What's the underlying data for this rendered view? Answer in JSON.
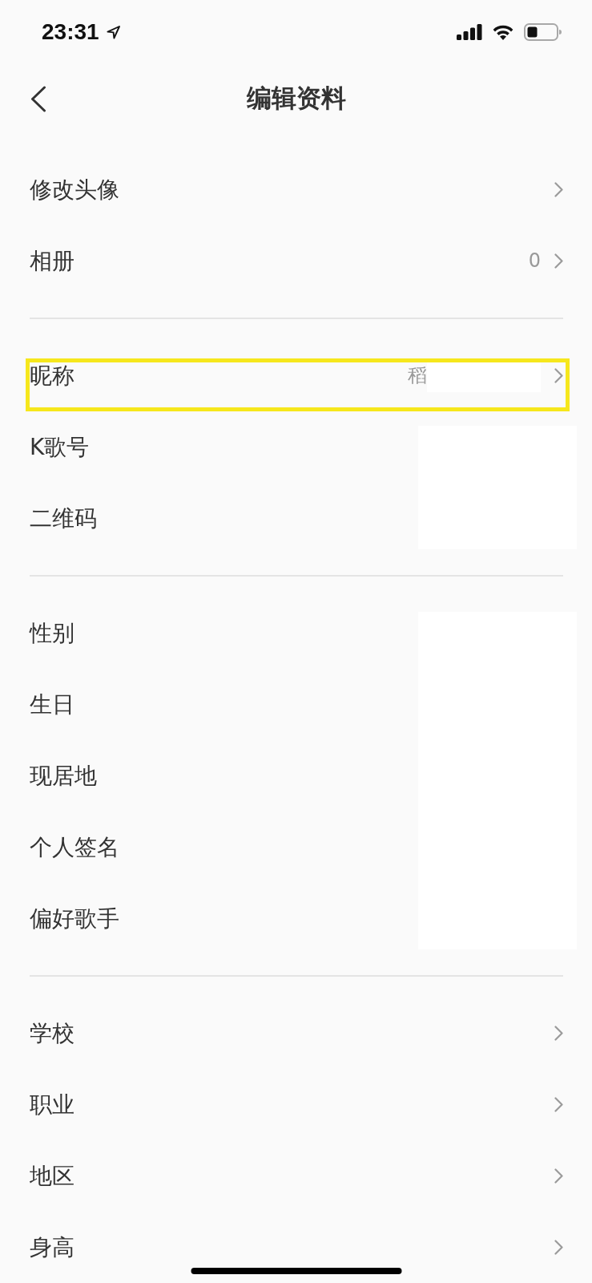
{
  "status_bar": {
    "time": "23:31"
  },
  "nav_bar": {
    "title": "编辑资料"
  },
  "sections": [
    {
      "items": [
        {
          "label": "修改头像",
          "chevron": true,
          "highlighted": false,
          "redacted": false
        },
        {
          "label": "相册",
          "value": "0",
          "value_masked": false,
          "chevron": true,
          "highlighted": false,
          "redacted": false
        }
      ]
    },
    {
      "items": [
        {
          "label": "昵称",
          "value": "稻",
          "value_masked": true,
          "chevron": true,
          "highlighted": true,
          "redacted": false
        },
        {
          "label": "K歌号",
          "highlighted": false,
          "redacted": true
        },
        {
          "label": "二维码",
          "highlighted": false,
          "redacted": true
        }
      ]
    },
    {
      "items": [
        {
          "label": "性别",
          "highlighted": false,
          "redacted": true
        },
        {
          "label": "生日",
          "highlighted": false,
          "redacted": true
        },
        {
          "label": "现居地",
          "highlighted": false,
          "redacted": true
        },
        {
          "label": "个人签名",
          "highlighted": false,
          "redacted": true
        },
        {
          "label": "偏好歌手",
          "highlighted": false,
          "redacted": true
        }
      ]
    },
    {
      "items": [
        {
          "label": "学校",
          "chevron": true,
          "highlighted": false,
          "redacted": false
        },
        {
          "label": "职业",
          "chevron": true,
          "highlighted": false,
          "redacted": false
        },
        {
          "label": "地区",
          "chevron": true,
          "highlighted": false,
          "redacted": false
        },
        {
          "label": "身高",
          "chevron": true,
          "highlighted": false,
          "redacted": false
        }
      ]
    }
  ]
}
